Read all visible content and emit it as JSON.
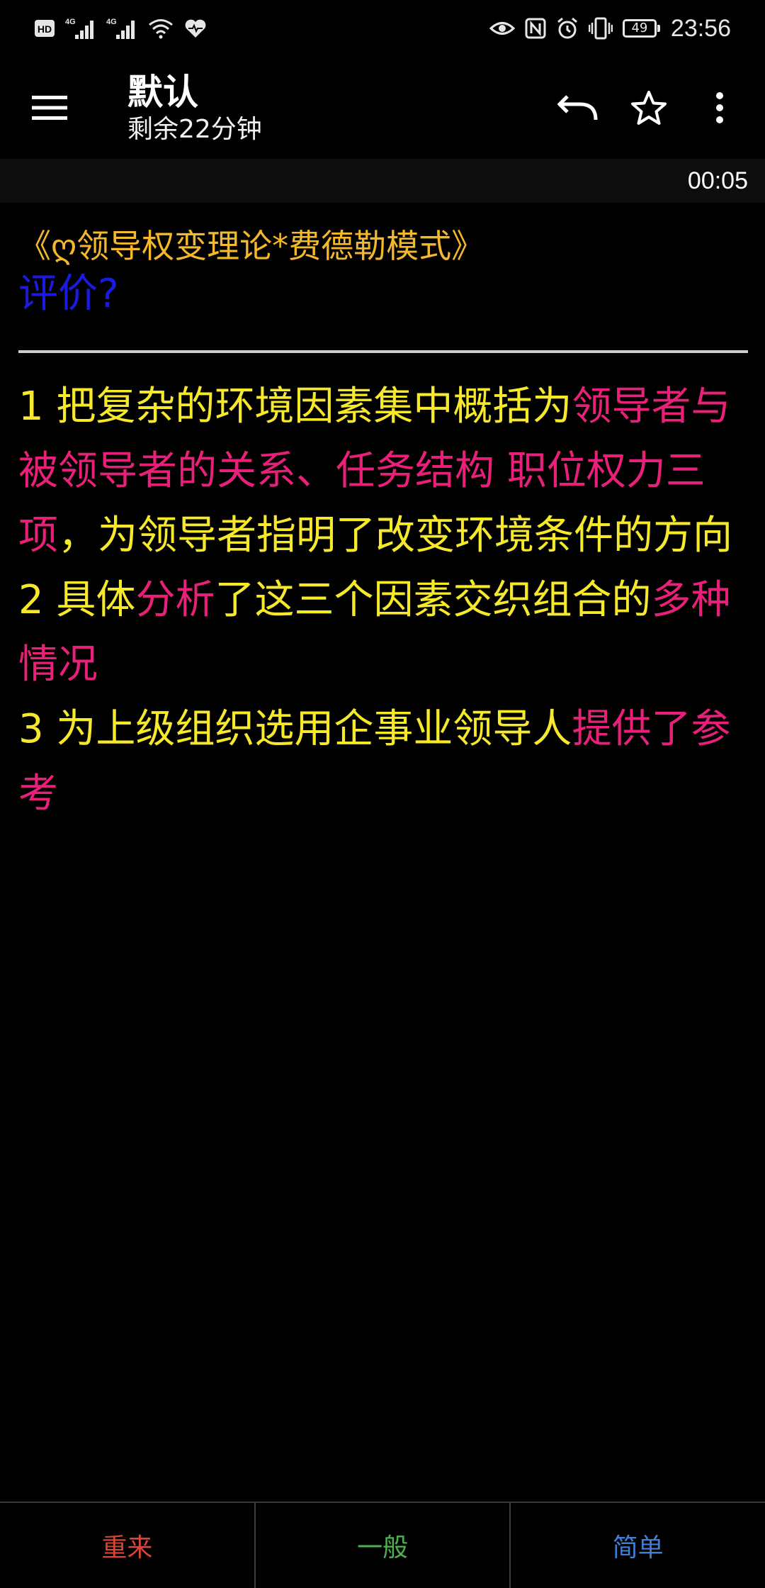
{
  "status_bar": {
    "left_icons": [
      "hd-icon",
      "signal-4g-icon",
      "signal-4g-icon",
      "wifi-icon",
      "health-icon"
    ],
    "right_icons": [
      "eye-icon",
      "nfc-icon",
      "alarm-icon",
      "vibrate-icon"
    ],
    "battery": "49",
    "time": "23:56"
  },
  "app_bar": {
    "title": "默认",
    "subtitle": "剩余22分钟",
    "menu_icon": "hamburger-menu-icon",
    "actions": [
      "undo-icon",
      "star-icon",
      "more-vert-icon"
    ]
  },
  "timer": "00:05",
  "card": {
    "topic": "《ღ领导权变理论*费德勒模式》",
    "question": "评价?",
    "answer": [
      [
        {
          "text": "1 把复杂的环境因素集中概括为",
          "hl": false
        },
        {
          "text": "领导者与被领导者的关系、任务结构 职位权力三项",
          "hl": true
        },
        {
          "text": "，为领导者指明了改变环境条件的方向",
          "hl": false
        }
      ],
      [
        {
          "text": "2 具体",
          "hl": false
        },
        {
          "text": "分析",
          "hl": true
        },
        {
          "text": "了这三个因素交织组合的",
          "hl": false
        },
        {
          "text": "多种情况",
          "hl": true
        }
      ],
      [
        {
          "text": "3 为上级组织选用企事业领导人",
          "hl": false
        },
        {
          "text": "提供了参考",
          "hl": true
        }
      ]
    ],
    "colors": {
      "topic": "#f5b82a",
      "question": "#1a1ae0",
      "answer": "#f6e82a",
      "highlight": "#e8207a"
    }
  },
  "bottom_buttons": [
    {
      "label": "重来",
      "color": "#d9453a"
    },
    {
      "label": "一般",
      "color": "#4caf50"
    },
    {
      "label": "简单",
      "color": "#3d7fd9"
    }
  ]
}
